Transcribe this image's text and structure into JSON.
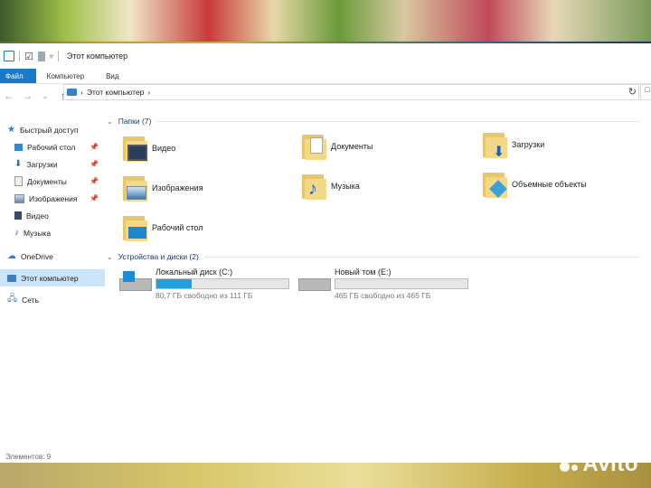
{
  "window": {
    "title": "Этот компьютер"
  },
  "ribbon": {
    "tabs": [
      "Файл",
      "Компьютер",
      "Вид"
    ]
  },
  "address": {
    "path": "Этот компьютер"
  },
  "sidebar": {
    "quick_access": "Быстрый доступ",
    "items": [
      "Рабочий стол",
      "Загрузки",
      "Документы",
      "Изображения",
      "Видео",
      "Музыка"
    ],
    "onedrive": "OneDrive",
    "this_pc": "Этот компьютер",
    "network": "Сеть"
  },
  "folders": {
    "header": "Папки (7)",
    "items": [
      "Видео",
      "Документы",
      "Загрузки",
      "Изображения",
      "Музыка",
      "Объемные объекты",
      "Рабочий стол"
    ]
  },
  "drives": {
    "header": "Устройства и диски (2)",
    "items": [
      {
        "name": "Локальный диск (C:)",
        "free_text": "80,7 ГБ свободно из 111 ГБ",
        "used_fraction": 0.27
      },
      {
        "name": "Новый том (E:)",
        "free_text": "465 ГБ свободно из 465 ГБ",
        "used_fraction": 0.0
      }
    ]
  },
  "status": {
    "items_count": "Элементов: 9"
  },
  "watermark": "Avito",
  "colors": {
    "accent": "#1979ca",
    "selection": "#cce4f7",
    "drive_fill": "#26a0da",
    "group_header": "#1e3a6e"
  }
}
